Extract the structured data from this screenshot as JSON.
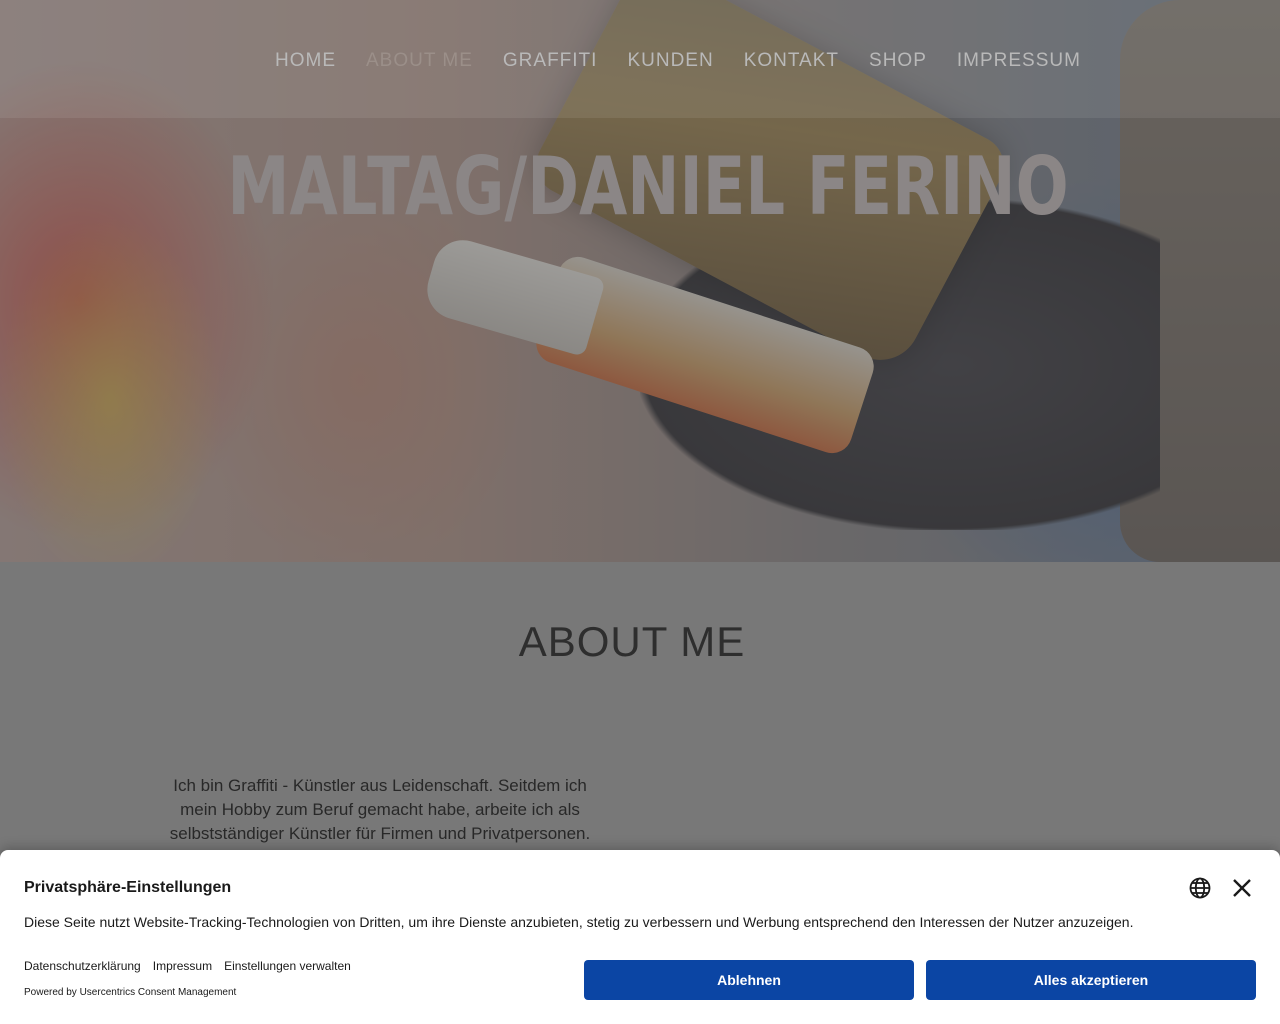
{
  "nav": {
    "items": [
      {
        "label": "HOME",
        "active": false
      },
      {
        "label": "ABOUT ME",
        "active": true
      },
      {
        "label": "GRAFFITI",
        "active": false
      },
      {
        "label": "KUNDEN",
        "active": false
      },
      {
        "label": "KONTAKT",
        "active": false
      },
      {
        "label": "SHOP",
        "active": false
      },
      {
        "label": "IMPRESSUM",
        "active": false
      }
    ]
  },
  "hero": {
    "title": "MALTAG/DANIEL FERINO"
  },
  "about": {
    "heading": "ABOUT ME",
    "text": "Ich bin Graffiti - Künstler aus Leidenschaft. Seitdem ich mein Hobby zum Beruf gemacht habe, arbeite ich als selbstständiger Künstler für Firmen und Privatpersonen."
  },
  "consent": {
    "title": "Privatsphäre-Einstellungen",
    "text": "Diese Seite nutzt Website-Tracking-Technologien von Dritten, um ihre Dienste anzubieten, stetig zu verbessern und Werbung entsprechend den Interessen der Nutzer anzuzeigen.",
    "links": {
      "privacy": "Datenschutzerklärung",
      "imprint": "Impressum",
      "settings": "Einstellungen verwalten"
    },
    "powered_by": "Powered by Usercentrics Consent Management",
    "deny_label": "Ablehnen",
    "accept_label": "Alles akzeptieren",
    "button_color": "#0b45a4",
    "icons": {
      "language": "globe-icon",
      "close": "close-icon"
    }
  }
}
